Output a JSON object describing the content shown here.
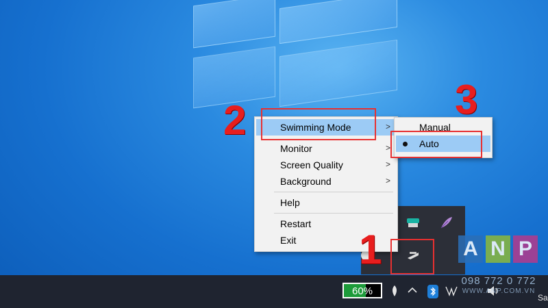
{
  "context_menu": {
    "items": [
      {
        "label": "Swimming Mode",
        "has_submenu": true,
        "highlighted": true
      },
      {
        "label": "Monitor",
        "has_submenu": true
      },
      {
        "label": "Screen Quality",
        "has_submenu": true
      },
      {
        "label": "Background",
        "has_submenu": true
      },
      {
        "label": "Help"
      },
      {
        "label": "Restart"
      },
      {
        "label": "Exit"
      }
    ],
    "arrow_glyph": ">"
  },
  "submenu": {
    "items": [
      {
        "label": "Manual",
        "selected": false
      },
      {
        "label": "Auto",
        "selected": true,
        "highlighted": true
      }
    ]
  },
  "annotations": {
    "step1": "1",
    "step2": "2",
    "step3": "3",
    "color": "#e81e1e"
  },
  "taskbar": {
    "battery_percent": 60,
    "battery_text": "60%",
    "clock_partial": "Sa"
  },
  "watermark": {
    "letters": [
      "A",
      "N",
      "P"
    ],
    "colors": [
      "#2b6fb7",
      "#8cb83c",
      "#b43a8c"
    ],
    "phone": "098 772 0 772",
    "site": "WWW.ANP.COM.VN"
  },
  "icons": {
    "tray_flyout": [
      "app-tray-icon",
      "feather-icon",
      "cursor-app-icon"
    ],
    "taskbar": [
      "feather-icon",
      "chevron-up-icon",
      "bluetooth-icon",
      "network-icon",
      "volume-icon"
    ]
  }
}
